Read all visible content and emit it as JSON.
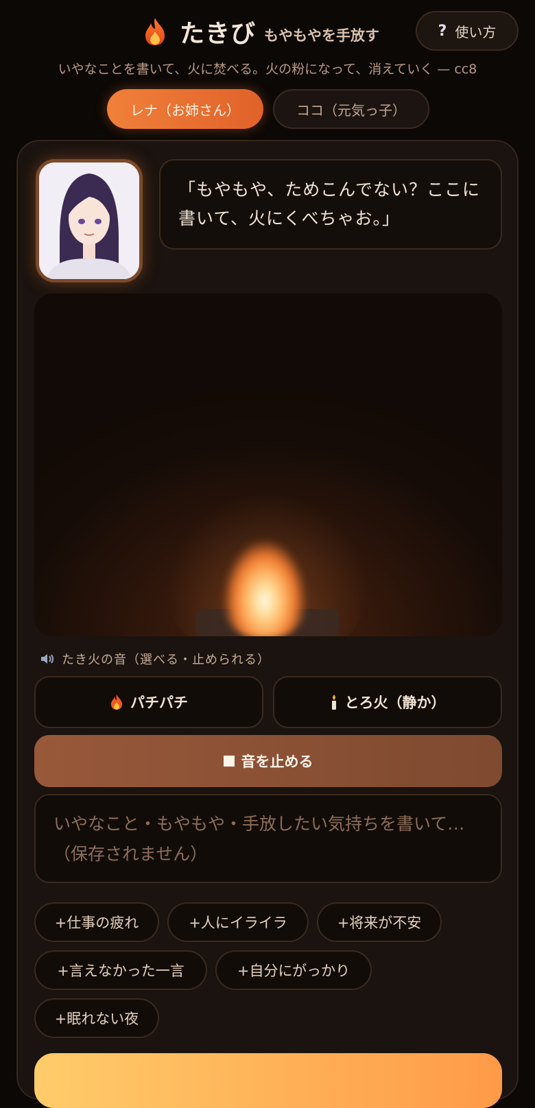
{
  "header": {
    "title": "たきび",
    "tagline": "もやもやを手放す",
    "help_icon": "?",
    "help_label": "使い方",
    "subtitle": "いやなことを書いて、火に焚べる。火の粉になって、消えていく — cc8"
  },
  "characters": [
    {
      "label": "レナ（お姉さん）",
      "active": true
    },
    {
      "label": "ココ（元気っ子）",
      "active": false
    }
  ],
  "speech": "「もやもや、ためこんでない？ここに書いて、火にくべちゃお。」",
  "sound": {
    "label": "たき火の音（選べる・止められる）",
    "options": [
      {
        "label": "パチパチ",
        "icon": "flame-icon"
      },
      {
        "label": "とろ火（静か）",
        "icon": "candle-icon"
      }
    ],
    "stop_label": "音を止める"
  },
  "input": {
    "placeholder": "いやなこと・もやもや・手放したい気持ちを書いて…（保存されません）"
  },
  "chips": [
    "+仕事の疲れ",
    "+人にイライラ",
    "+将来が不安",
    "+言えなかった一言",
    "+自分にがっかり",
    "+眠れない夜"
  ],
  "colors": {
    "accent": "#f0803a",
    "background": "#0c0806",
    "card": "#1a130f"
  }
}
